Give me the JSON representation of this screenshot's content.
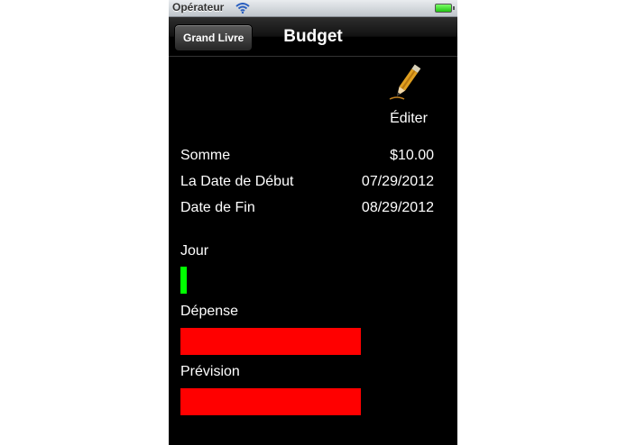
{
  "status": {
    "carrier": "Opérateur"
  },
  "nav": {
    "back_label": "Grand Livre",
    "title": "Budget"
  },
  "edit": {
    "label": "Éditer",
    "icon": "pencil-icon"
  },
  "details": [
    {
      "label": "Somme",
      "value": "$10.00"
    },
    {
      "label": "La Date de Début",
      "value": "07/29/2012"
    },
    {
      "label": "Date de Fin",
      "value": "08/29/2012"
    }
  ],
  "progress": [
    {
      "label": "Jour",
      "fraction": 0.025,
      "color": "#00ff00"
    },
    {
      "label": "Dépense",
      "fraction": 0.71,
      "color": "#ff0000"
    },
    {
      "label": "Prévision",
      "fraction": 0.71,
      "color": "#ff0000"
    }
  ]
}
